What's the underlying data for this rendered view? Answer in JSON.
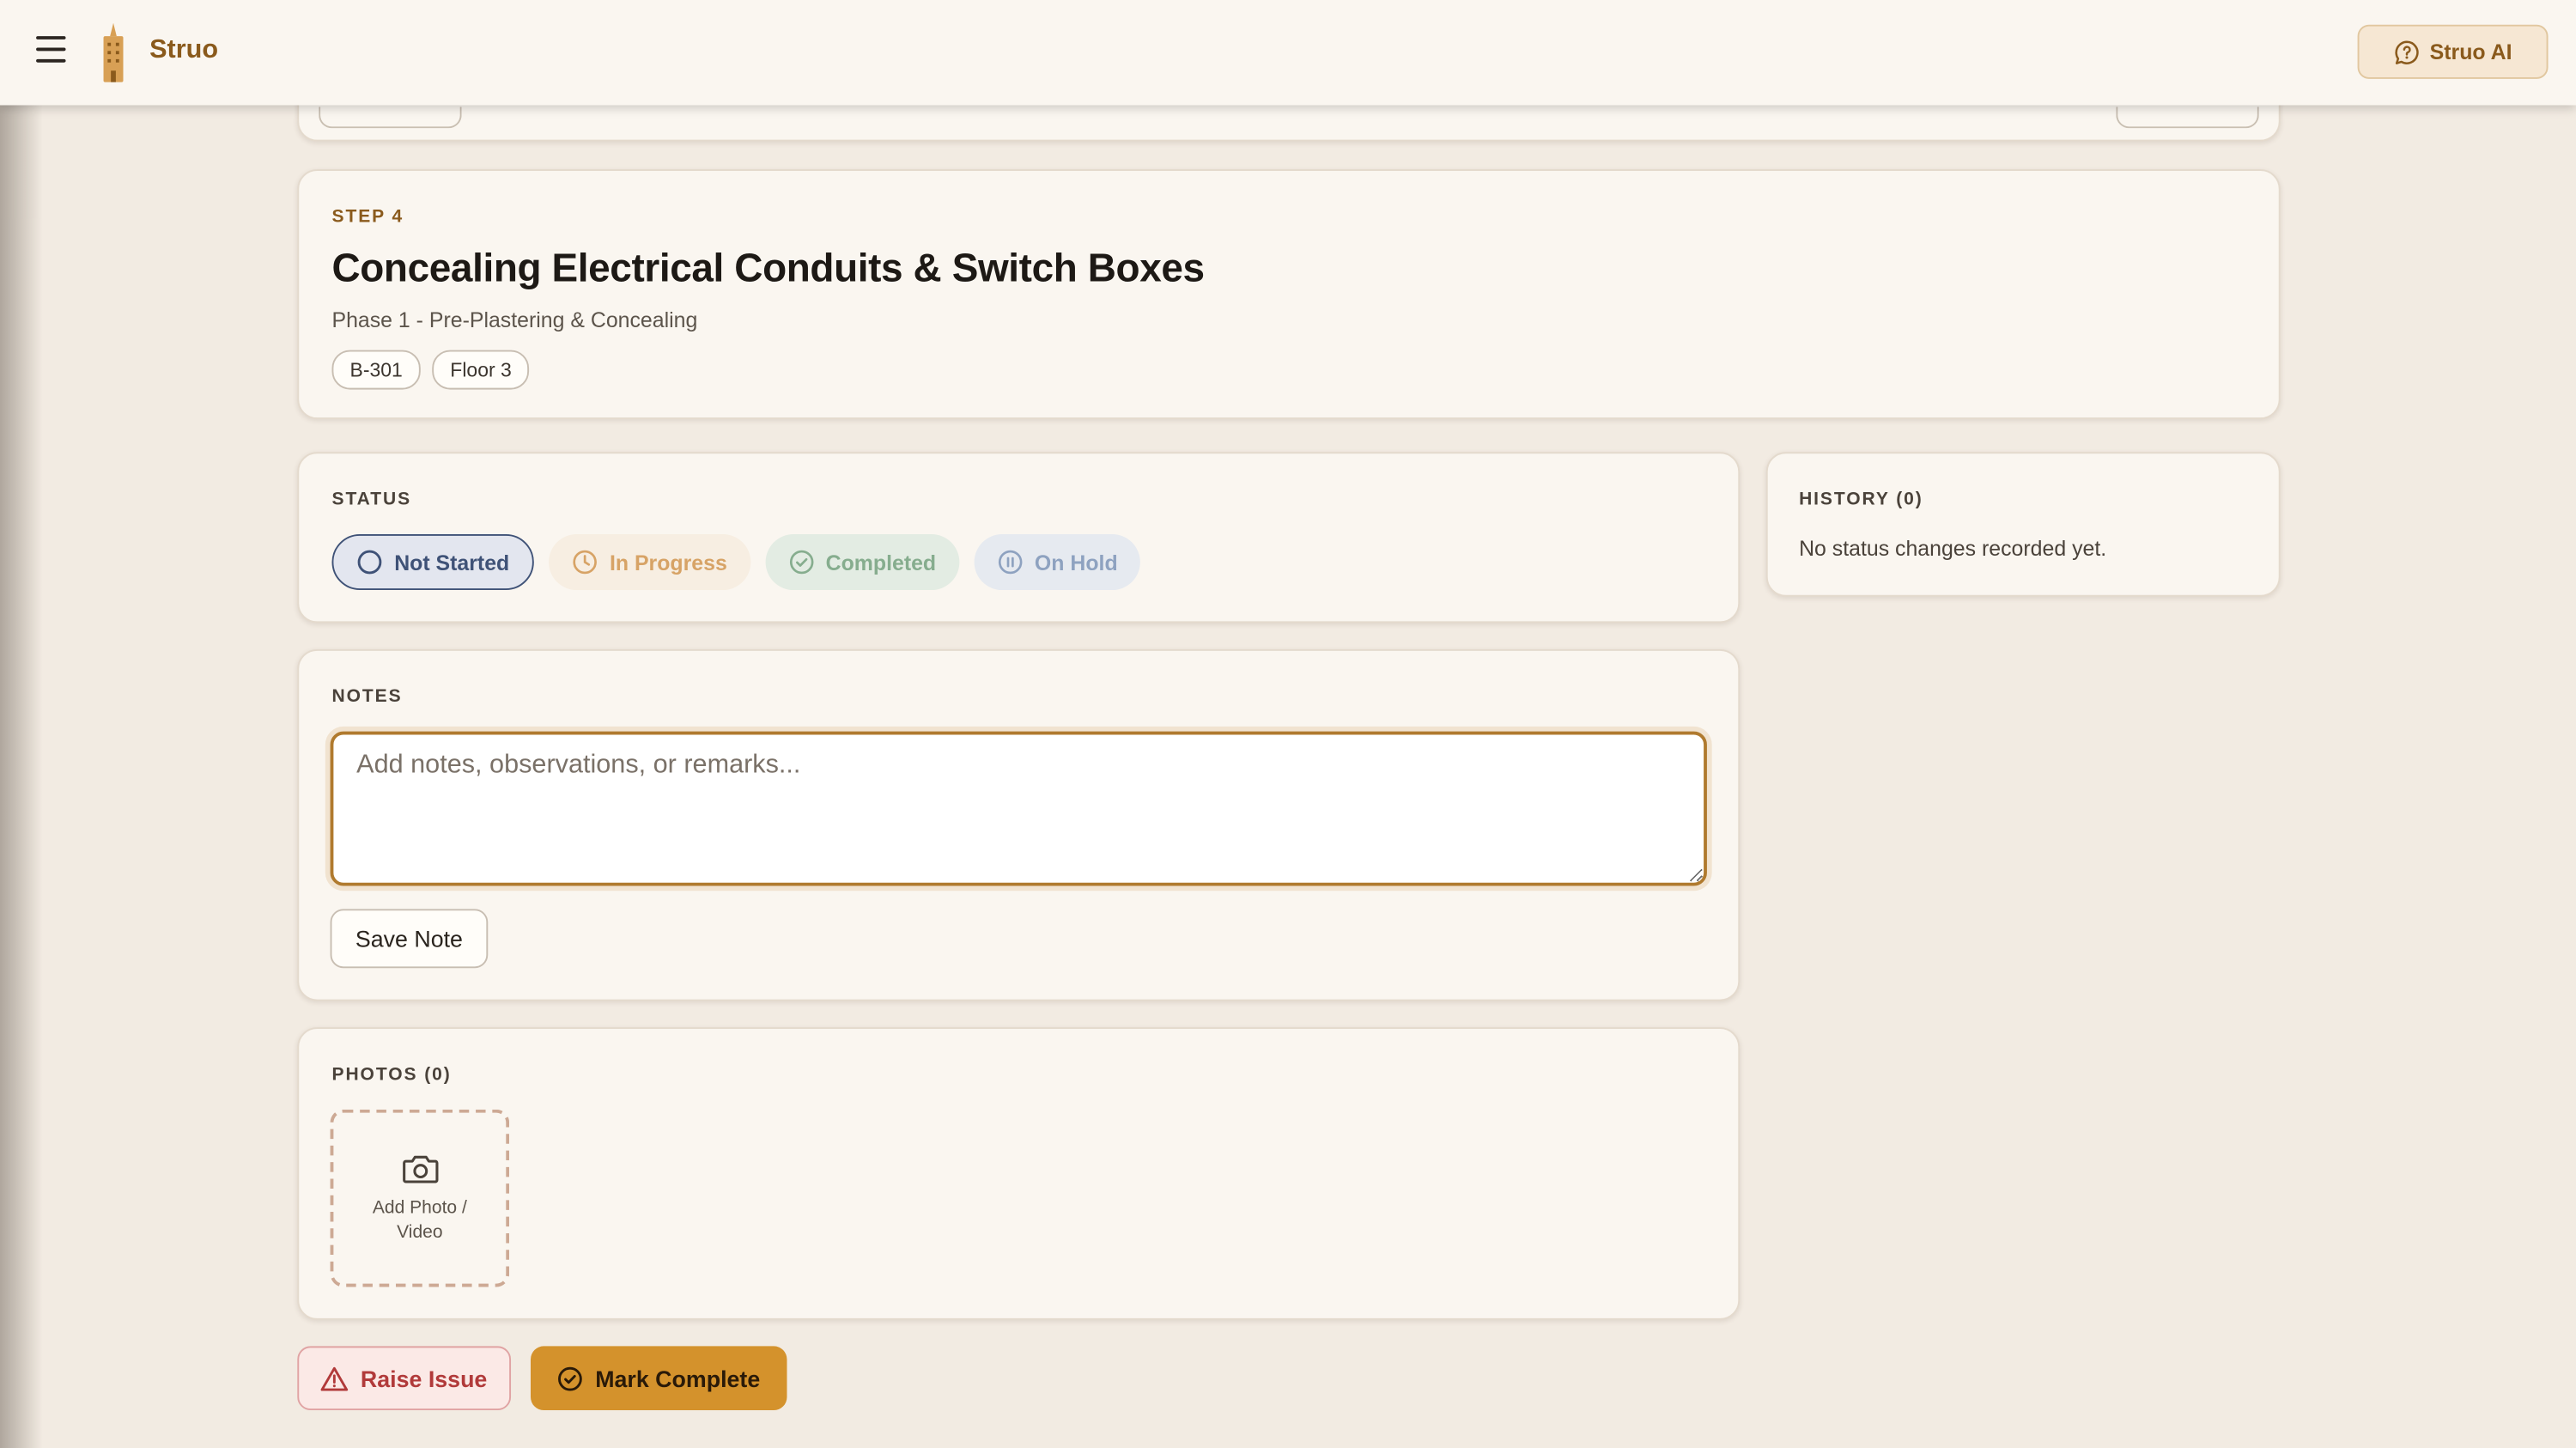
{
  "app": {
    "brand": "Struo",
    "ai_button_label": "Struo AI"
  },
  "step": {
    "label": "STEP 4",
    "title": "Concealing Electrical Conduits & Switch Boxes",
    "phase": "Phase 1 - Pre-Plastering & Concealing",
    "tags": [
      "B-301",
      "Floor 3"
    ]
  },
  "status": {
    "heading": "STATUS",
    "selected": "Not Started",
    "options": [
      {
        "label": "Not Started",
        "icon": "circle-icon"
      },
      {
        "label": "In Progress",
        "icon": "clock-icon"
      },
      {
        "label": "Completed",
        "icon": "check-circle-icon"
      },
      {
        "label": "On Hold",
        "icon": "pause-circle-icon"
      }
    ]
  },
  "history": {
    "heading": "HISTORY (0)",
    "empty_text": "No status changes recorded yet."
  },
  "notes": {
    "heading": "NOTES",
    "placeholder": "Add notes, observations, or remarks...",
    "value": "",
    "save_label": "Save Note"
  },
  "photos": {
    "heading": "PHOTOS (0)",
    "add_label": "Add Photo / Video"
  },
  "actions": {
    "raise_issue_label": "Raise Issue",
    "mark_complete_label": "Mark Complete"
  },
  "colors": {
    "accent": "#d4922c",
    "brand": "#8a5a1c",
    "background": "#f2ebe2",
    "card": "#faf6f0",
    "danger": "#b13a3a"
  }
}
